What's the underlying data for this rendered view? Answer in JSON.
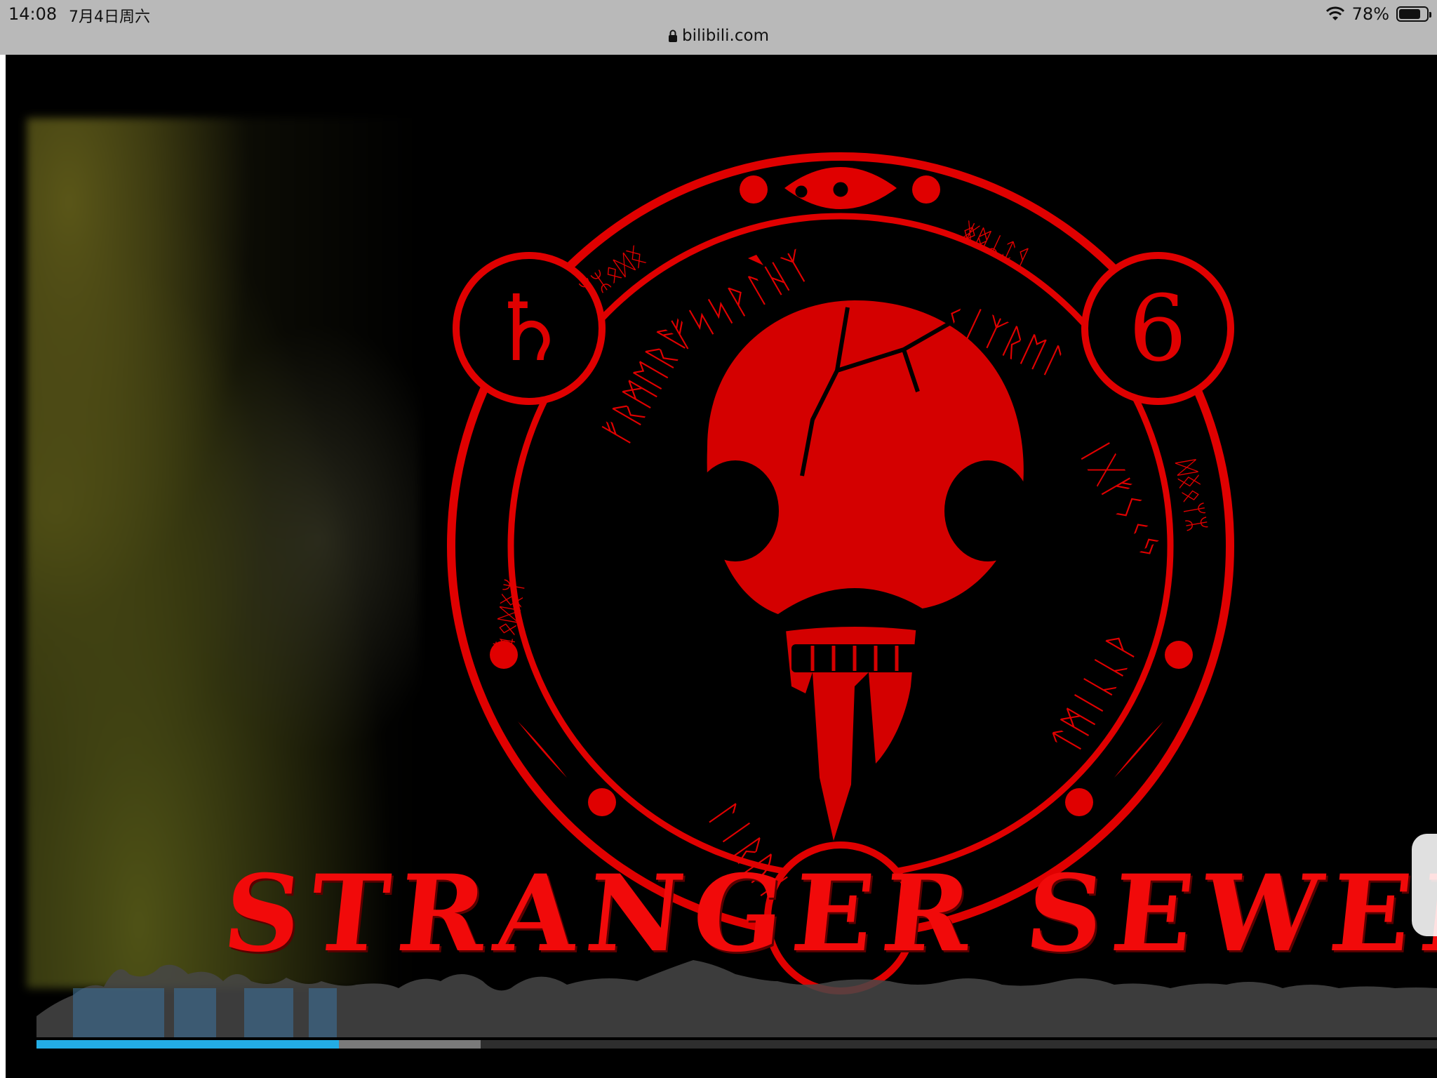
{
  "status_bar": {
    "time": "14:08",
    "date": "7月4日周六",
    "battery": "78%",
    "battery_level": 0.78,
    "url": "bilibili.com"
  },
  "video": {
    "title_art": "STRANGER SEWERS",
    "emblem_glyph_left": "♄",
    "emblem_glyph_right": "6",
    "played_fraction": 0.216,
    "buffered_fraction": 0.317,
    "accent_color": "#23ade5",
    "emblem_color": "#e00000"
  },
  "icons": {
    "lock": "lock-icon",
    "wifi": "wifi-icon",
    "battery": "battery-icon"
  }
}
